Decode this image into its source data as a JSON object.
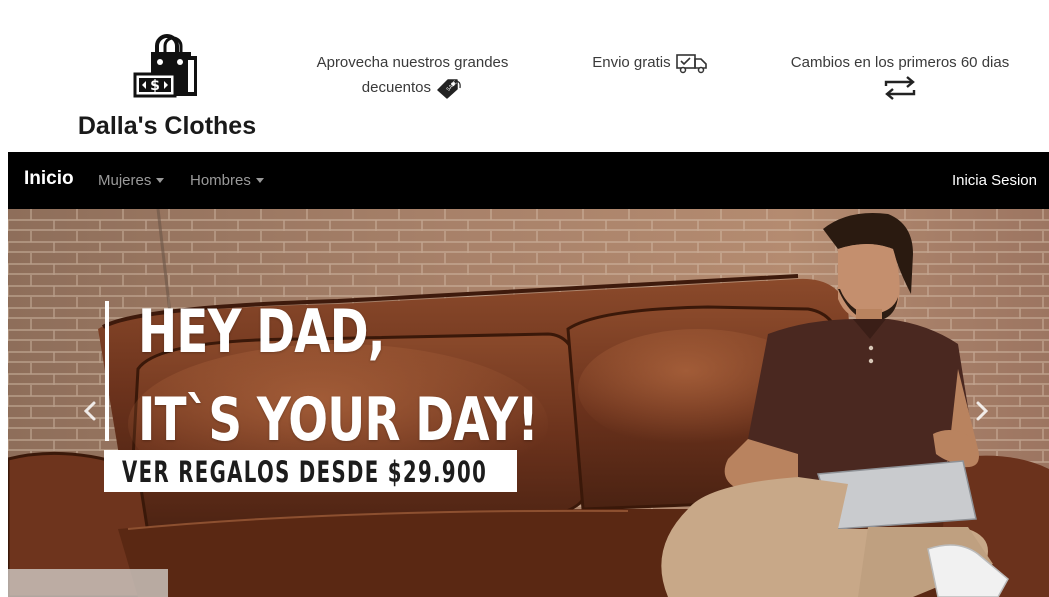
{
  "brand": {
    "name": "Dalla's Clothes"
  },
  "promos": [
    {
      "text": "Aprovecha nuestros grandes decuentos",
      "icon": "sale-tag-icon"
    },
    {
      "text": "Envio gratis",
      "icon": "delivery-truck-icon"
    },
    {
      "text": "Cambios en los primeros 60 dias",
      "icon": "exchange-arrows-icon"
    }
  ],
  "nav": {
    "home": "Inicio",
    "women": "Mujeres",
    "men": "Hombres",
    "login": "Inicia Sesion"
  },
  "hero": {
    "line1": "HEY DAD,",
    "line2": "IT`S YOUR DAY!",
    "cta": "VER REGALOS DESDE $29.900"
  },
  "colors": {
    "navbar": "#000000",
    "brick": "#a4775c",
    "sofa": "#6e341d",
    "shirt": "#4a2820"
  }
}
